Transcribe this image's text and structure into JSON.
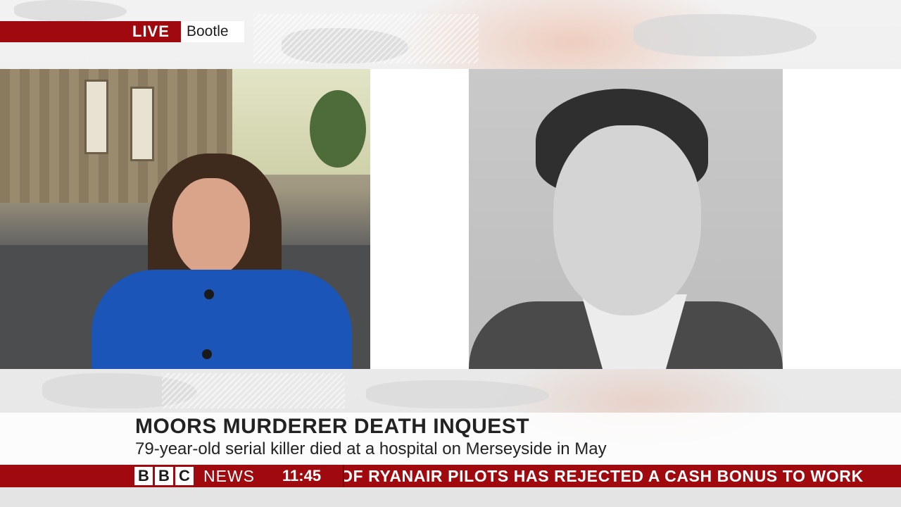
{
  "live_banner": {
    "live_label": "LIVE",
    "location": "Bootle"
  },
  "lower_third": {
    "headline": "MOORS MURDERER DEATH INQUEST",
    "subline": "79-year-old serial killer died at a hospital on Merseyside in May"
  },
  "ticker": {
    "brand_letters": [
      "B",
      "B",
      "C"
    ],
    "brand_word": "NEWS",
    "time": "11:45",
    "scroll_text": "OF RYANAIR PILOTS HAS REJECTED A CASH BONUS TO WORK"
  },
  "colors": {
    "brand_red": "#a0090e",
    "coat_blue": "#1b55b8"
  }
}
